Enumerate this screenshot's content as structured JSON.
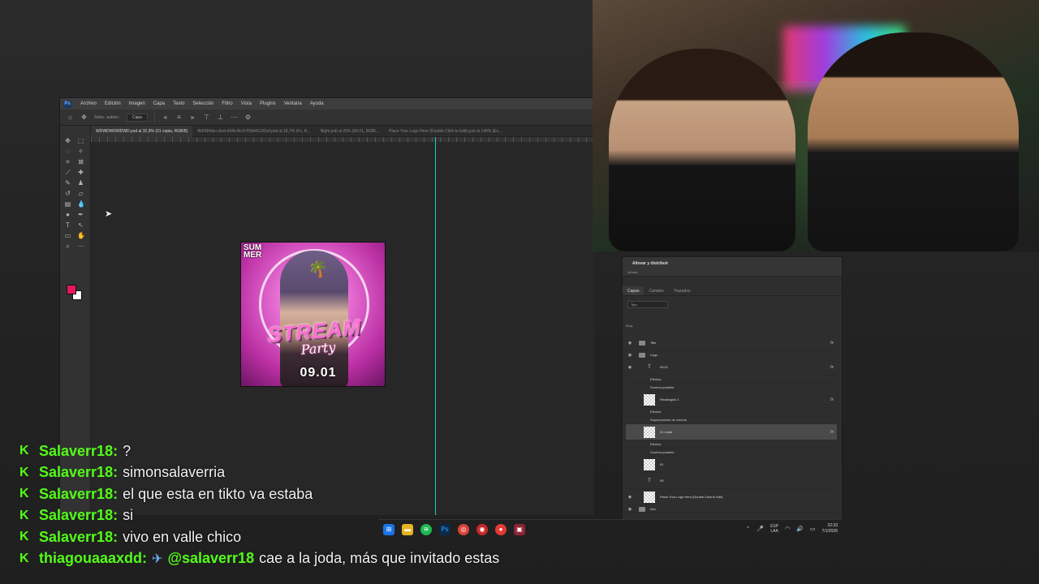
{
  "photoshop": {
    "menu": [
      "Archivo",
      "Edición",
      "Imagen",
      "Capa",
      "Texto",
      "Selección",
      "Filtro",
      "Vista",
      "Plugins",
      "Ventana",
      "Ayuda"
    ],
    "options": {
      "auto_select": "Selec. autom.:",
      "auto_select_value": "Capa"
    },
    "tabs": [
      "WDWDWDWDWD.psd al 32,9% (01 copia, RGB/8)",
      "8b5984de-c9cd-434b-8e1f-f59b4613f1ef.psd al 18,7% (Fo, R...",
      "Night.psb al 25% (09.01, RGB/...",
      "Place Your Logo Here (Double Click to Edit).psb al 146% (Ex..."
    ],
    "colors": {
      "foreground": "#e8175d",
      "background": "#ffffff",
      "guide": "#12d6c0"
    },
    "artwork": {
      "summer": "SUM MER",
      "stream": "STREAM",
      "party": "Party",
      "date": "09.01"
    }
  },
  "layers_panel": {
    "title": "Alinear y distribuir",
    "subtitle": "Alinear:",
    "tabs": [
      "Capas",
      "Canales",
      "Trazados"
    ],
    "filter": "Tipo",
    "lock_label": "Bloq.:",
    "layers": [
      {
        "name": "Title",
        "kind": "folder"
      },
      {
        "name": "Logo",
        "kind": "folder"
      },
      {
        "name": "09.01",
        "kind": "text"
      },
      {
        "name": "Efectos",
        "kind": "effect"
      },
      {
        "name": "Sombra paralela",
        "kind": "effect"
      },
      {
        "name": "Rectángulo 1",
        "kind": "shape"
      },
      {
        "name": "Efectos",
        "kind": "effect"
      },
      {
        "name": "Superposición de colores",
        "kind": "effect"
      },
      {
        "name": "01 copia",
        "kind": "raster"
      },
      {
        "name": "Efectos",
        "kind": "effect"
      },
      {
        "name": "Sombra paralela",
        "kind": "effect"
      },
      {
        "name": "01",
        "kind": "raster"
      },
      {
        "name": "09",
        "kind": "text"
      },
      {
        "name": "Place Your Logo Here (Double Click to Edit)",
        "kind": "smart"
      },
      {
        "name": "Info",
        "kind": "folder"
      }
    ],
    "fx_label": "fx"
  },
  "taskbar": {
    "lang": [
      "ESP",
      "LAA"
    ],
    "time": "22:33",
    "date": "7/1/2026"
  },
  "chat": [
    {
      "user": "Salaverr18",
      "message": "?"
    },
    {
      "user": "Salaverr18",
      "message": "simonsalaverria"
    },
    {
      "user": "Salaverr18",
      "message": "el que esta en tikto va estaba"
    },
    {
      "user": "Salaverr18",
      "message": "si"
    },
    {
      "user": "Salaverr18",
      "message": "vivo en valle chico"
    },
    {
      "user": "thiagouaaaxdd",
      "mention": "@salaverr18",
      "message": "cae a la joda, más que invitado estas"
    }
  ]
}
